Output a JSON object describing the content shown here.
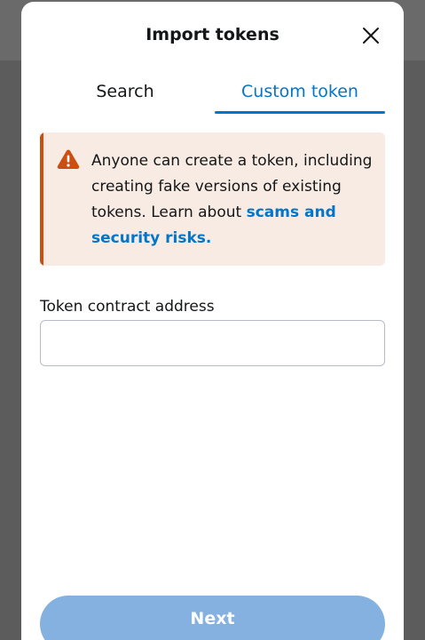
{
  "modal": {
    "title": "Import tokens"
  },
  "tabs": [
    {
      "label": "Search",
      "active": false
    },
    {
      "label": "Custom token",
      "active": true
    }
  ],
  "warning": {
    "text": "Anyone can create a token, including creating fake versions of existing tokens. Learn about ",
    "link_text": "scams and security risks."
  },
  "contract_field": {
    "label": "Token contract address",
    "value": "",
    "placeholder": ""
  },
  "next_button": {
    "label": "Next",
    "enabled": false
  },
  "colors": {
    "accent": "#0376c9",
    "warning": "#ca4f12",
    "warning_bg": "#f7ebe3",
    "disabled_button": "#85b1e0",
    "overlay": "#5c5c5c"
  },
  "icons": {
    "close": "close-icon",
    "warning": "warning-triangle-icon"
  }
}
